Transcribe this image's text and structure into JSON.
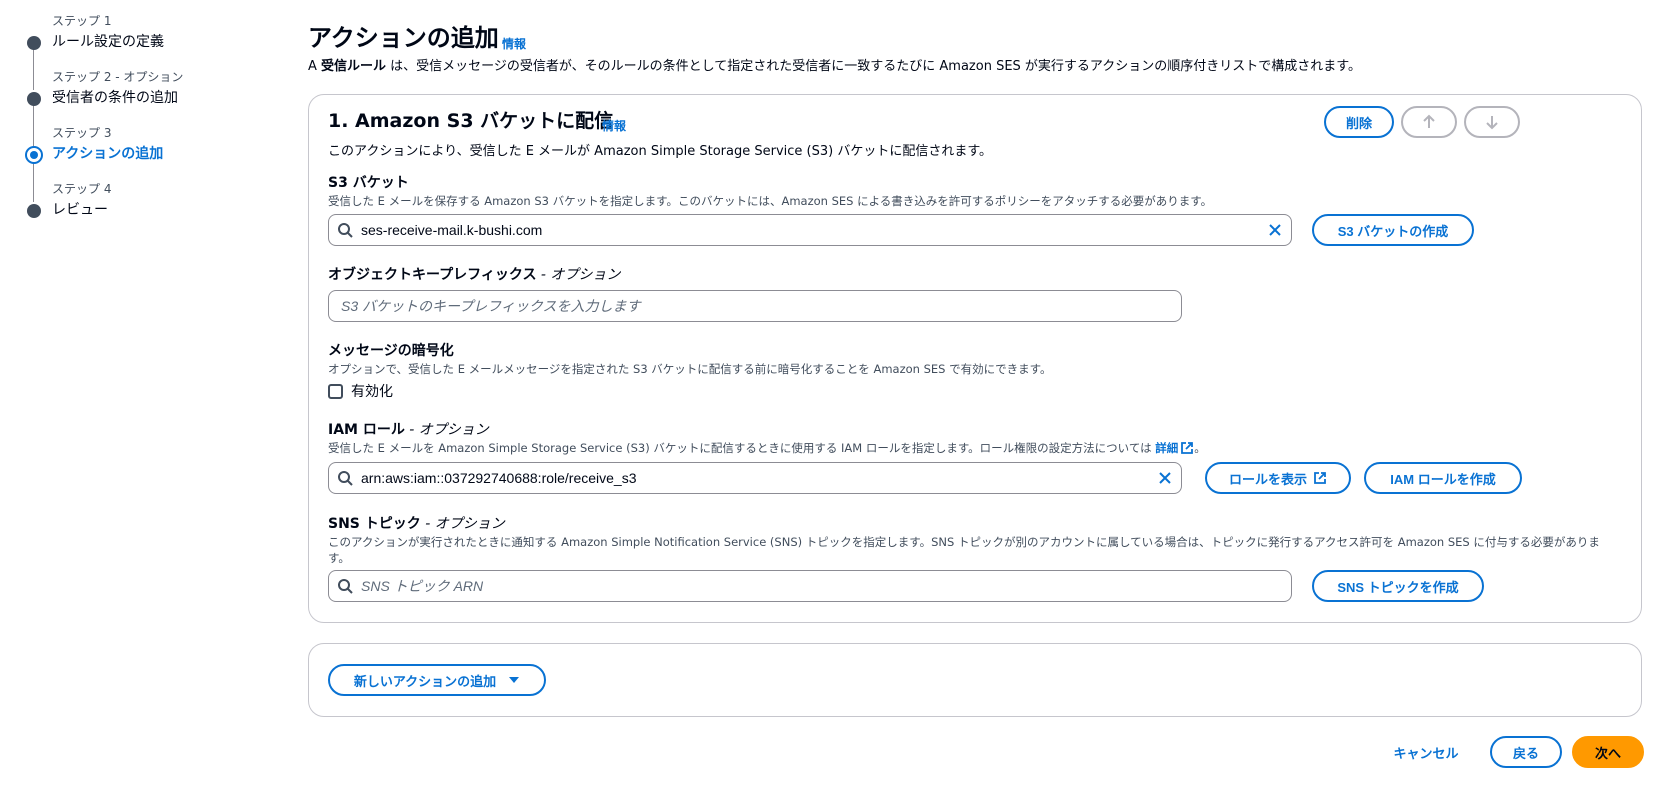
{
  "steps": [
    {
      "small": "ステップ 1",
      "title": "ルール設定の定義"
    },
    {
      "small": "ステップ 2 - オプション",
      "title": "受信者の条件の追加"
    },
    {
      "small": "ステップ 3",
      "title": "アクションの追加"
    },
    {
      "small": "ステップ 4",
      "title": "レビュー"
    }
  ],
  "header": {
    "title": "アクションの追加",
    "info": "情報",
    "desc_prefix": "A ",
    "desc_bold": "受信ルール",
    "desc_suffix": " は、受信メッセージの受信者が、そのルールの条件として指定された受信者に一致するたびに Amazon SES が実行するアクションの順序付きリストで構成されます。"
  },
  "action": {
    "title": "1. Amazon S3 バケットに配信",
    "info": "情報",
    "desc": "このアクションにより、受信した E メールが Amazon Simple Storage Service (S3) バケットに配信されます。",
    "delete_label": "削除",
    "s3": {
      "label": "S3 バケット",
      "desc": "受信した E メールを保存する Amazon S3 バケットを指定します。このバケットには、Amazon SES による書き込みを許可するポリシーをアタッチする必要があります。",
      "value": "ses-receive-mail.k-bushi.com",
      "create_label": "S3 バケットの作成"
    },
    "prefix": {
      "label": "オブジェクトキープレフィックス",
      "optional": " - オプション",
      "placeholder": "S3 バケットのキープレフィックスを入力します"
    },
    "encrypt": {
      "label": "メッセージの暗号化",
      "desc": "オプションで、受信した E メールメッセージを指定された S3 バケットに配信する前に暗号化することを Amazon SES で有効にできます。",
      "checkbox_label": "有効化"
    },
    "iam": {
      "label": "IAM ロール",
      "optional": " - オプション",
      "desc": "受信した E メールを Amazon Simple Storage Service (S3) バケットに配信するときに使用する IAM ロールを指定します。ロール権限の設定方法については ",
      "desc_link": "詳細",
      "desc_end": "。",
      "value": "arn:aws:iam::037292740688:role/receive_s3",
      "view_label": "ロールを表示",
      "create_label": "IAM ロールを作成"
    },
    "sns": {
      "label": "SNS トピック",
      "optional": " - オプション",
      "desc1": "このアクションが実行されたときに通知する Amazon Simple Notification Service (SNS) トピックを指定します。SNS トピックが別のアカウントに属している場合は、トピックに発行するアクセス許可を Amazon SES に付与する必要がありま",
      "desc2": "す。",
      "placeholder": "SNS トピック ARN",
      "create_label": "SNS トピックを作成"
    }
  },
  "add_action_label": "新しいアクションの追加",
  "footer": {
    "cancel": "キャンセル",
    "back": "戻る",
    "next": "次へ"
  },
  "colors": {
    "accent": "#0972d3",
    "primary": "#ff9900"
  }
}
